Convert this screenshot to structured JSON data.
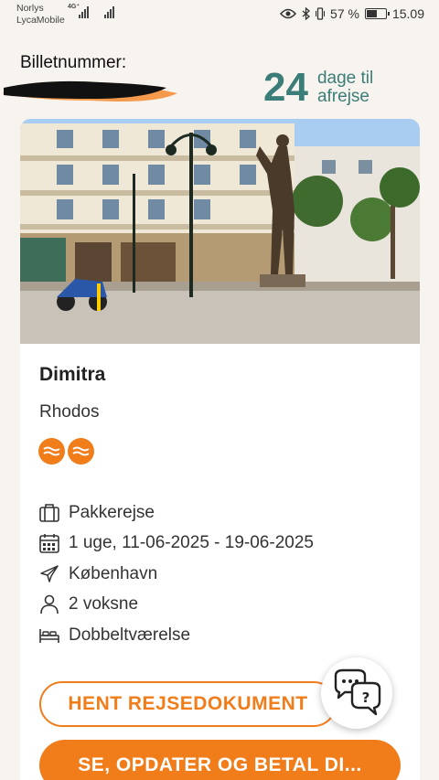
{
  "status_bar": {
    "carrier_1": "Norlys",
    "carrier_2": "LycaMobile",
    "network": "4G⁺",
    "battery_percent": "57 %",
    "battery_level": 0.57,
    "time": "15.09"
  },
  "header": {
    "ticket_label": "Billetnummer:",
    "days": "24",
    "days_text_1": "dage til",
    "days_text_2": "afrejse"
  },
  "trip": {
    "hotel_name": "Dimitra",
    "destination": "Rhodos",
    "rating": 2,
    "details": [
      {
        "icon": "suitcase-icon",
        "label": "Pakkerejse"
      },
      {
        "icon": "calendar-icon",
        "label": "1 uge, 11-06-2025 - 19-06-2025"
      },
      {
        "icon": "airplane-icon",
        "label": "København"
      },
      {
        "icon": "person-icon",
        "label": "2 voksne"
      },
      {
        "icon": "bed-icon",
        "label": "Dobbeltværelse"
      }
    ]
  },
  "actions": {
    "download_label": "HENT REJSEDOKUMENT",
    "pay_label": "SE, OPDATER OG BETAL DI..."
  },
  "colors": {
    "accent": "#f07c1a",
    "teal": "#3b7d78",
    "background": "#f7f3ef"
  }
}
